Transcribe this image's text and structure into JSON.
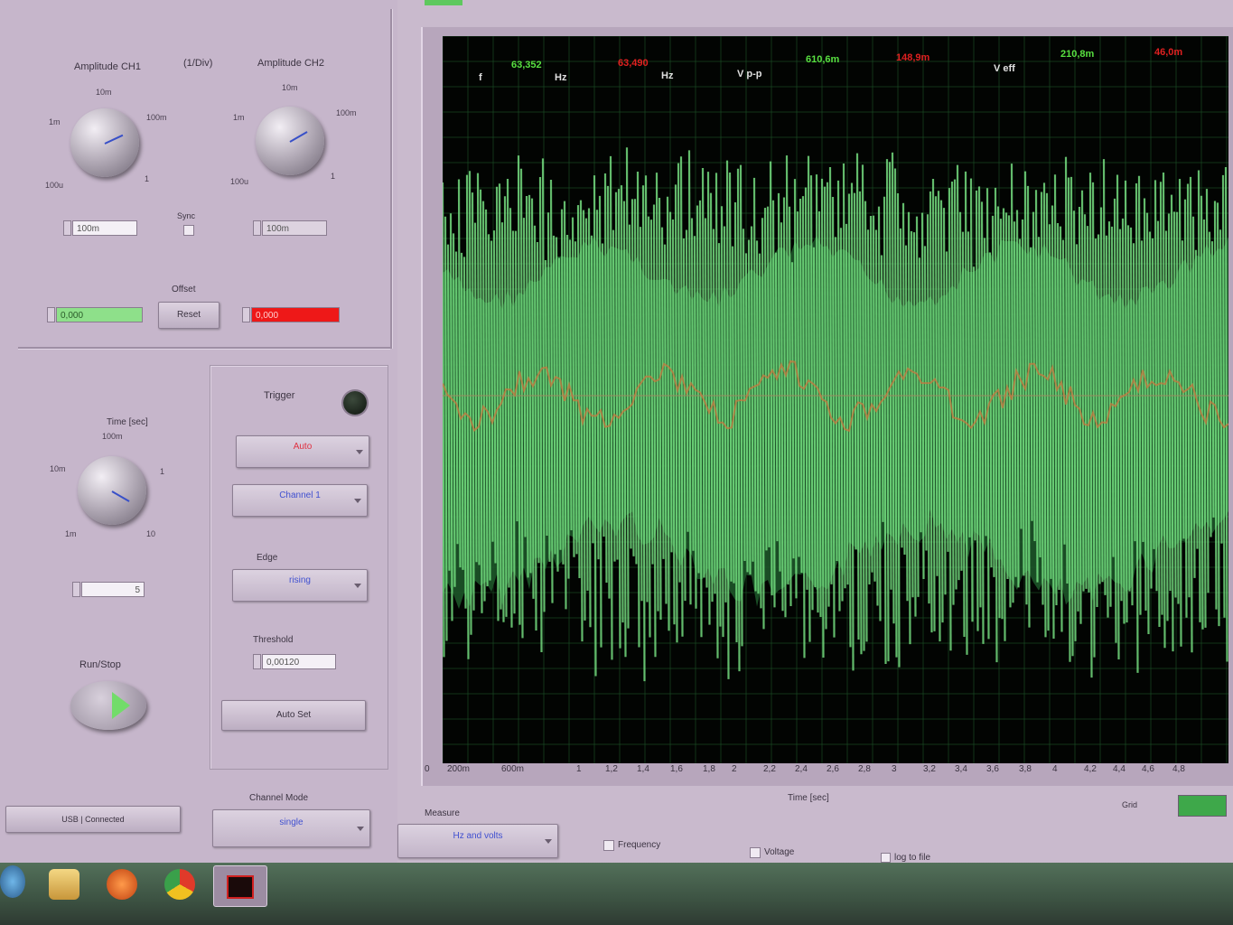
{
  "channels": {
    "units_label": "(1/Div)",
    "ch1": {
      "title": "Amplitude CH1",
      "ticks": [
        "1m",
        "10m",
        "100m",
        "100u",
        "1"
      ],
      "value": "100m",
      "offset_value": "0,000"
    },
    "ch2": {
      "title": "Amplitude CH2",
      "ticks": [
        "1m",
        "10m",
        "100m",
        "100u",
        "1"
      ],
      "value": "100m",
      "offset_value": "0,000"
    },
    "sync_label": "Sync",
    "offset_label": "Offset",
    "reset_label": "Reset"
  },
  "timebase": {
    "title": "Time [sec]",
    "ticks": [
      "100m",
      "10m",
      "1",
      "1m",
      "10"
    ],
    "value": "5"
  },
  "trigger": {
    "title": "Trigger",
    "mode": "Auto",
    "source": "Channel 1",
    "edge_label": "Edge",
    "edge": "rising",
    "threshold_label": "Threshold",
    "threshold": "0,00120",
    "autoset_label": "Auto Set"
  },
  "run": {
    "label": "Run/Stop"
  },
  "channel_mode": {
    "label": "Channel Mode",
    "value": "single"
  },
  "connect_label": "USB | Connected",
  "measurements": [
    {
      "text": "f",
      "color": "#e0e0e0"
    },
    {
      "text": "63,352",
      "color": "#58e040"
    },
    {
      "text": "Hz",
      "color": "#e0e0e0"
    },
    {
      "text": "63,490",
      "color": "#e02020"
    },
    {
      "text": "Hz",
      "color": "#e0e0e0"
    },
    {
      "text": "V p-p",
      "color": "#e0e0e0"
    },
    {
      "text": "610,6m",
      "color": "#58e040"
    },
    {
      "text": "148,9m",
      "color": "#e02020"
    },
    {
      "text": "V eff",
      "color": "#e0e0e0"
    },
    {
      "text": "210,8m",
      "color": "#58e040"
    },
    {
      "text": "46,0m",
      "color": "#e02020"
    }
  ],
  "graph": {
    "x_ticks": [
      "0",
      "200m",
      "600m",
      "1",
      "1,2",
      "1,4",
      "1,6",
      "1,8",
      "2",
      "2,2",
      "2,4",
      "2,6",
      "2,8",
      "3",
      "3,2",
      "3,4",
      "3,6",
      "3,8",
      "4",
      "4,2",
      "4,4",
      "4,6",
      "4,8"
    ],
    "x_label": "Time [sec]",
    "grid_label": "Grid",
    "colors": {
      "ch1": "#7ae886",
      "ch2": "#c87840",
      "background": "#020402",
      "grid": "#1e5a2a"
    }
  },
  "measure": {
    "label": "Measure",
    "value": "Hz and volts",
    "frequency_label": "Frequency",
    "voltage_label": "Voltage",
    "log_label": "log to file"
  }
}
